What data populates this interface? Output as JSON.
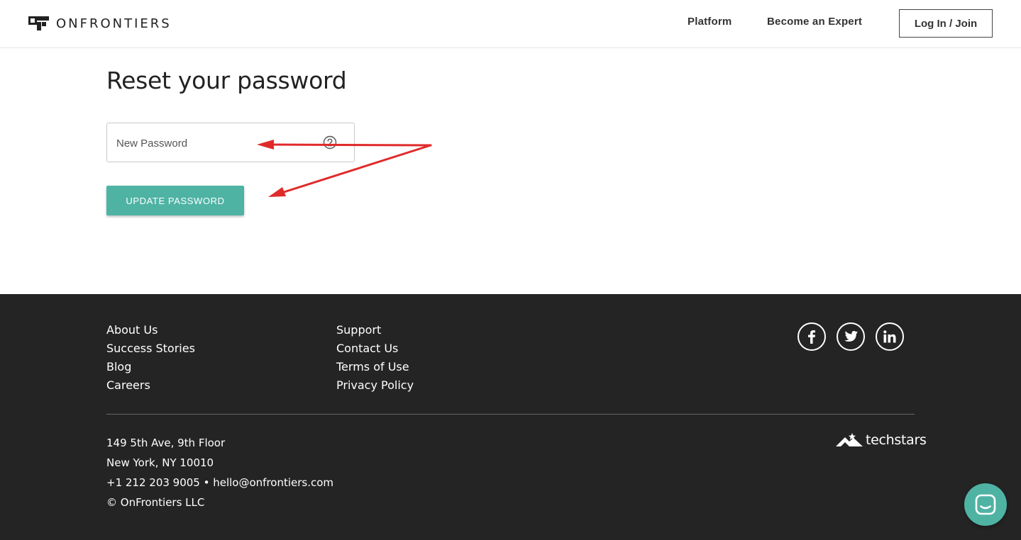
{
  "header": {
    "logo_text": "ONFRONTIERS",
    "nav": {
      "platform": "Platform",
      "become_expert": "Become an Expert",
      "login": "Log In / Join"
    }
  },
  "main": {
    "title": "Reset your password",
    "password_placeholder": "New Password",
    "update_button": "UPDATE PASSWORD"
  },
  "footer": {
    "col1": [
      "About Us",
      "Success Stories",
      "Blog",
      "Careers"
    ],
    "col2": [
      "Support",
      "Contact Us",
      "Terms of Use",
      "Privacy Policy"
    ],
    "address": {
      "line1": "149 5th Ave, 9th Floor",
      "line2": "New York, NY 10010",
      "line3": "+1 212 203 9005 • hello@onfrontiers.com",
      "line4": "© OnFrontiers LLC"
    },
    "partner": "techstars",
    "social": [
      "facebook-icon",
      "twitter-icon",
      "linkedin-icon"
    ]
  },
  "colors": {
    "accent": "#4fb3a4",
    "footer_bg": "#242424",
    "annotation": "#e02a2a"
  }
}
